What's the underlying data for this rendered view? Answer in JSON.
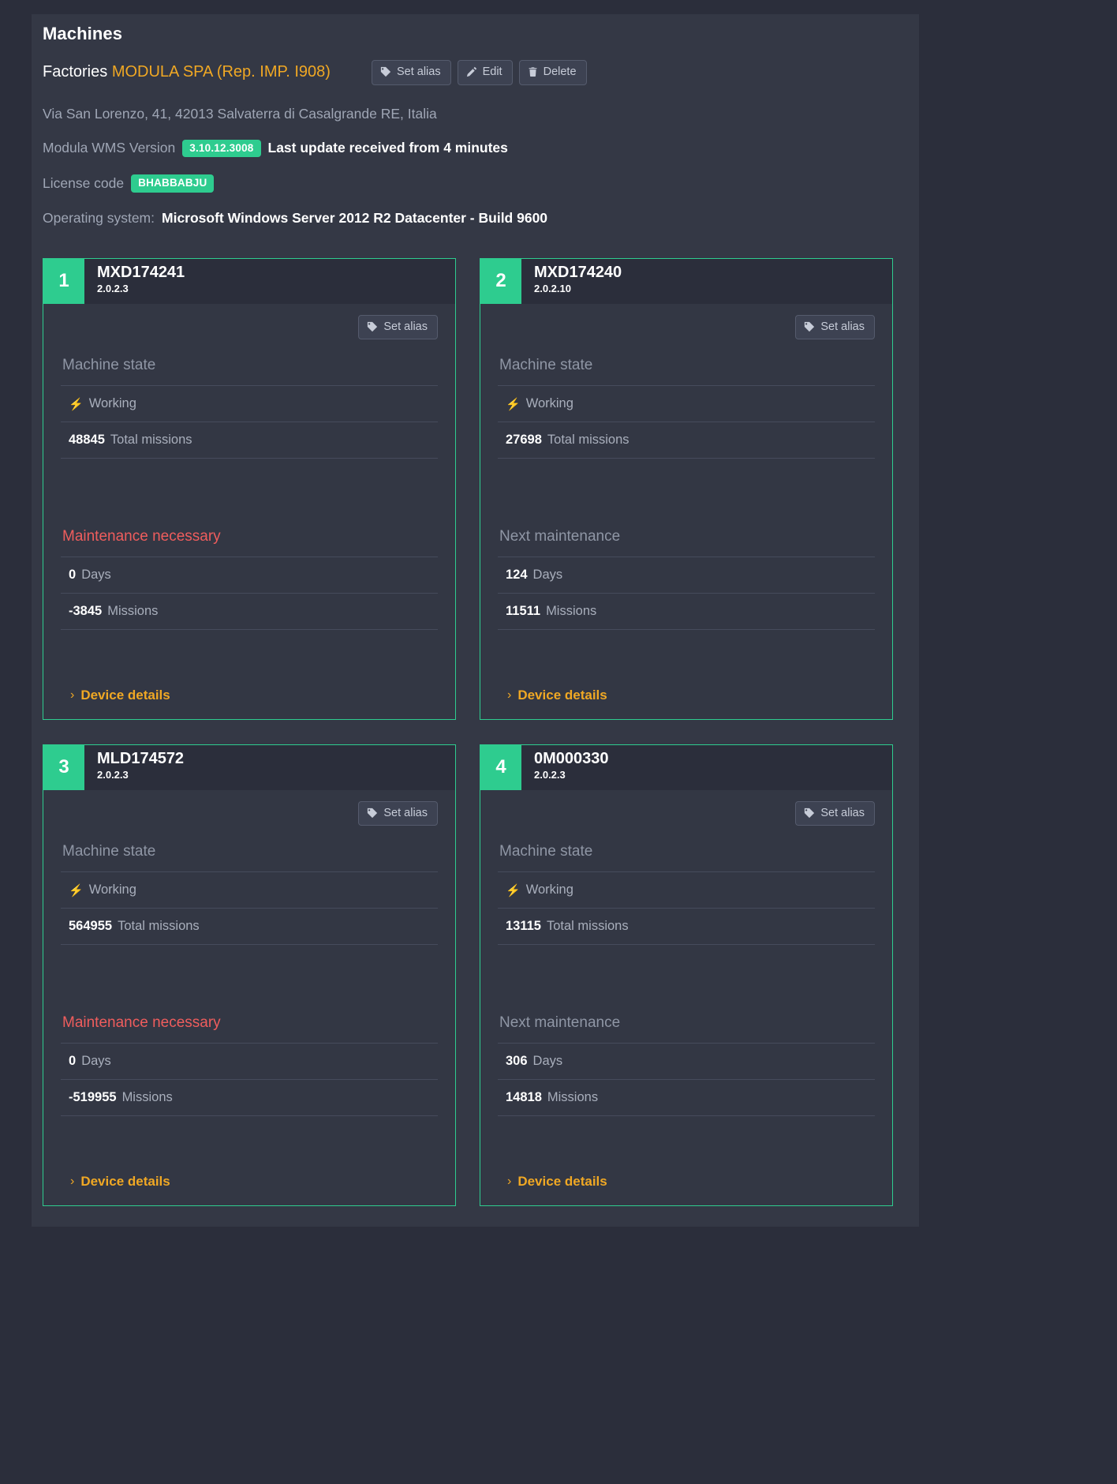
{
  "page": {
    "title": "Machines"
  },
  "breadcrumb": {
    "root": "Factories",
    "current": "MODULA SPA (Rep. IMP. I908)"
  },
  "toolbar": {
    "set_alias_label": "Set alias",
    "edit_label": "Edit",
    "delete_label": "Delete"
  },
  "info": {
    "address": "Via San Lorenzo, 41, 42013 Salvaterra di Casalgrande RE, Italia",
    "wms_version_label": "Modula WMS Version",
    "wms_version_value": "3.10.12.3008",
    "last_update": "Last update received from 4 minutes",
    "license_label": "License code",
    "license_value": "BHABBABJU",
    "os_label": "Operating system:",
    "os_value": "Microsoft Windows Server 2012 R2 Datacenter - Build 9600"
  },
  "labels": {
    "set_alias": "Set alias",
    "machine_state": "Machine state",
    "total_missions": "Total missions",
    "days": "Days",
    "missions": "Missions",
    "device_details": "Device details",
    "chevron": "›"
  },
  "cards": [
    {
      "index": "1",
      "name": "MXD174241",
      "version": "2.0.2.3",
      "set_alias": "Set alias",
      "machine_state_label": "Machine state",
      "state": "Working",
      "total_missions_value": "48845",
      "total_missions_label": "Total missions",
      "maintenance_label": "Maintenance necessary",
      "maintenance_danger": true,
      "days_value": "0",
      "days_label": "Days",
      "missions_value": "-3845",
      "missions_label": "Missions",
      "details_label": "Device details"
    },
    {
      "index": "2",
      "name": "MXD174240",
      "version": "2.0.2.10",
      "set_alias": "Set alias",
      "machine_state_label": "Machine state",
      "state": "Working",
      "total_missions_value": "27698",
      "total_missions_label": "Total missions",
      "maintenance_label": "Next maintenance",
      "maintenance_danger": false,
      "days_value": "124",
      "days_label": "Days",
      "missions_value": "11511",
      "missions_label": "Missions",
      "details_label": "Device details"
    },
    {
      "index": "3",
      "name": "MLD174572",
      "version": "2.0.2.3",
      "set_alias": "Set alias",
      "machine_state_label": "Machine state",
      "state": "Working",
      "total_missions_value": "564955",
      "total_missions_label": "Total missions",
      "maintenance_label": "Maintenance necessary",
      "maintenance_danger": true,
      "days_value": "0",
      "days_label": "Days",
      "missions_value": "-519955",
      "missions_label": "Missions",
      "details_label": "Device details"
    },
    {
      "index": "4",
      "name": "0M000330",
      "version": "2.0.2.3",
      "set_alias": "Set alias",
      "machine_state_label": "Machine state",
      "state": "Working",
      "total_missions_value": "13115",
      "total_missions_label": "Total missions",
      "maintenance_label": "Next maintenance",
      "maintenance_danger": false,
      "days_value": "306",
      "days_label": "Days",
      "missions_value": "14818",
      "missions_label": "Missions",
      "details_label": "Device details"
    }
  ],
  "colors": {
    "accent_green": "#2ecc8f",
    "accent_orange": "#f0a824",
    "danger_red": "#ef5d5d",
    "panel_bg": "#343845",
    "page_bg": "#2b2e3b"
  }
}
